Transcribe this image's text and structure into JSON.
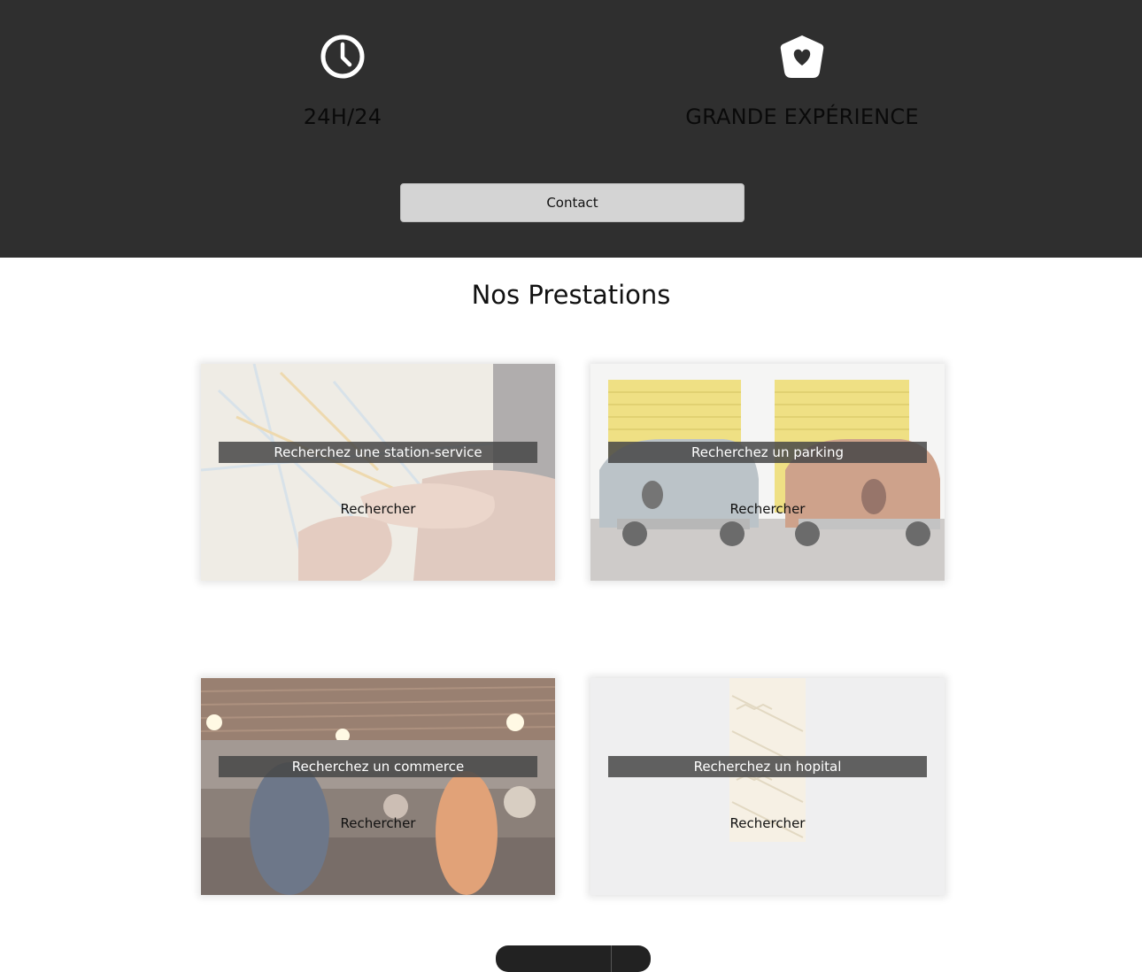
{
  "hero": {
    "features": [
      {
        "icon": "clock-icon",
        "title": "24H/24"
      },
      {
        "icon": "shield-heart-icon",
        "title": "GRANDE EXPÉRIENCE"
      }
    ],
    "contact_label": "Contact",
    "background_color": "#2f2f2f"
  },
  "services": {
    "title": "Nos Prestations",
    "cards": [
      {
        "label": "Recherchez une station-service",
        "button": "Rechercher",
        "image": "map-in-hands"
      },
      {
        "label": "Recherchez un parking",
        "button": "Rechercher",
        "image": "vintage-cars-garage"
      },
      {
        "label": "Recherchez un commerce",
        "button": "Rechercher",
        "image": "busy-bar"
      },
      {
        "label": "Recherchez un hopital",
        "button": "Rechercher",
        "image": "staircase"
      }
    ]
  }
}
